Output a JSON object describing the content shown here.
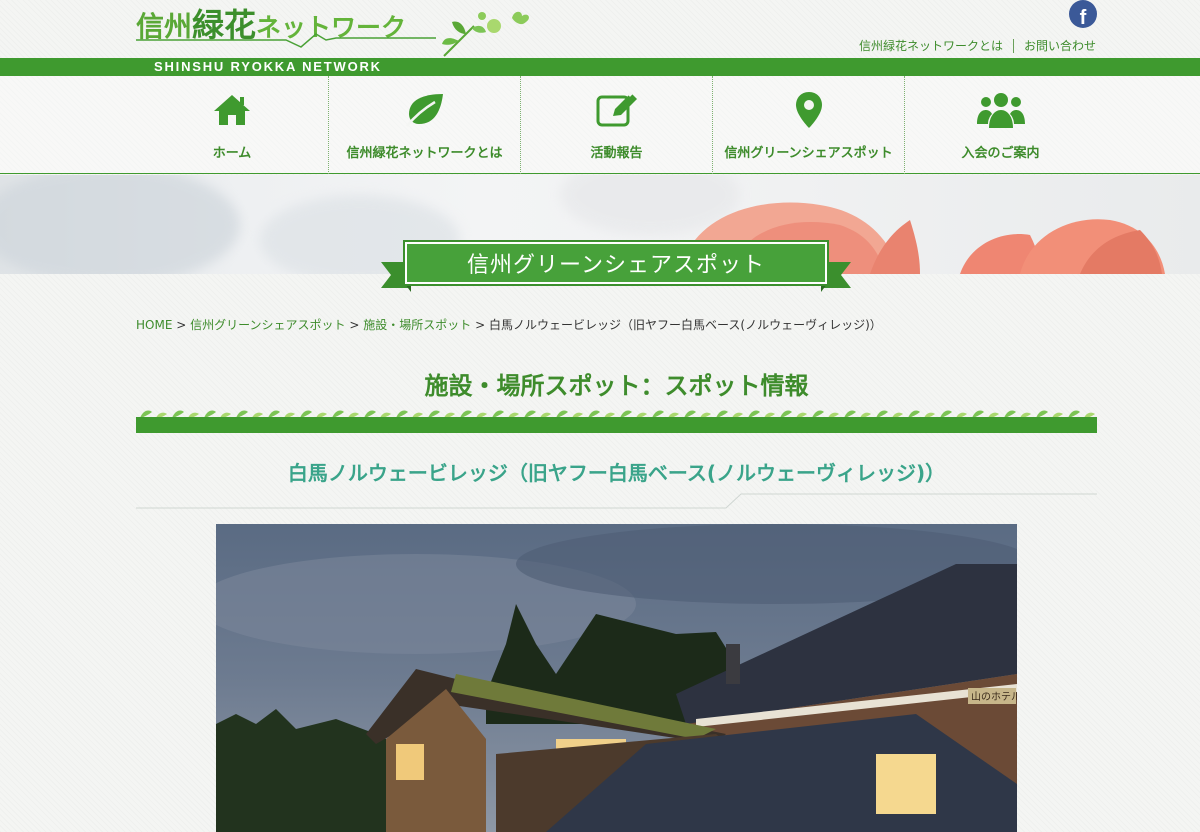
{
  "header": {
    "logo_text": {
      "part1": "信州",
      "part2": "緑花",
      "part3": "ネットワーク"
    },
    "tagline": "SHINSHU RYOKKA NETWORK",
    "facebook_glyph": "f",
    "top_links": [
      "信州緑花ネットワークとは",
      "お問い合わせ"
    ]
  },
  "nav": {
    "items": [
      {
        "label": "ホーム",
        "icon": "home-icon"
      },
      {
        "label": "信州緑花ネットワークとは",
        "icon": "leaf-icon"
      },
      {
        "label": "活動報告",
        "icon": "edit-icon"
      },
      {
        "label": "信州グリーンシェアスポット",
        "icon": "map-pin-icon"
      },
      {
        "label": "入会のご案内",
        "icon": "users-icon"
      }
    ]
  },
  "hero": {
    "banner_title": "信州グリーンシェアスポット"
  },
  "breadcrumb": {
    "items": [
      "HOME",
      "信州グリーンシェアスポット",
      "施設・場所スポット"
    ],
    "separator": ">",
    "current": "白馬ノルウェービレッジ（旧ヤフー白馬ベース(ノルウェーヴィレッジ)）"
  },
  "main": {
    "section_title": "施設・場所スポット：スポット情報",
    "spot_title": "白馬ノルウェービレッジ（旧ヤフー白馬ベース(ノルウェーヴィレッジ)）",
    "photo_sign": "山のホテル"
  },
  "colors": {
    "brand_green": "#3f9a2f",
    "text_green": "#3e8c2c",
    "teal": "#3aa48a",
    "facebook": "#3b5998"
  }
}
